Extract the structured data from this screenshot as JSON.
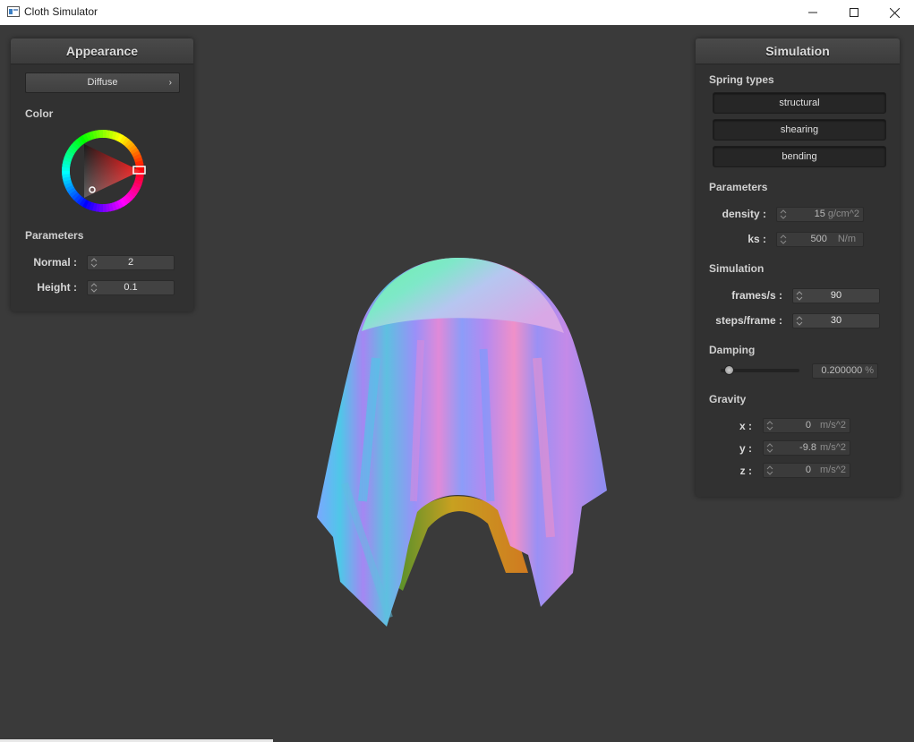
{
  "window": {
    "title": "Cloth Simulator",
    "minimize_glyph": "—",
    "maximize_glyph": "☐",
    "close_glyph": "✕"
  },
  "appearance": {
    "header": "Appearance",
    "shader_value": "Diffuse",
    "shader_chevron": "›",
    "color_label": "Color",
    "color_hex": "#ff0000",
    "parameters_label": "Parameters",
    "normal_label": "Normal :",
    "normal_value": "2",
    "height_label": "Height :",
    "height_value": "0.1"
  },
  "simulation": {
    "header": "Simulation",
    "spring_types_label": "Spring types",
    "spring_types": [
      "structural",
      "shearing",
      "bending"
    ],
    "parameters_label": "Parameters",
    "density_label": "density :",
    "density_value": "15",
    "density_unit": "g/cm^2",
    "ks_label": "ks :",
    "ks_value": "500",
    "ks_unit": "N/m",
    "simulation_label": "Simulation",
    "fps_label": "frames/s :",
    "fps_value": "90",
    "steps_label": "steps/frame :",
    "steps_value": "30",
    "damping_label": "Damping",
    "damping_value": "0.200000",
    "damping_unit": "%",
    "damping_fraction": 0.2,
    "gravity_label": "Gravity",
    "gx_label": "x :",
    "gx_value": "0",
    "gy_label": "y :",
    "gy_value": "-9.8",
    "gz_label": "z :",
    "gz_value": "0",
    "gravity_unit": "m/s^2"
  },
  "colors": {
    "background": "#3a3a3a",
    "panel": "#313131",
    "accent": "#ff0000"
  }
}
